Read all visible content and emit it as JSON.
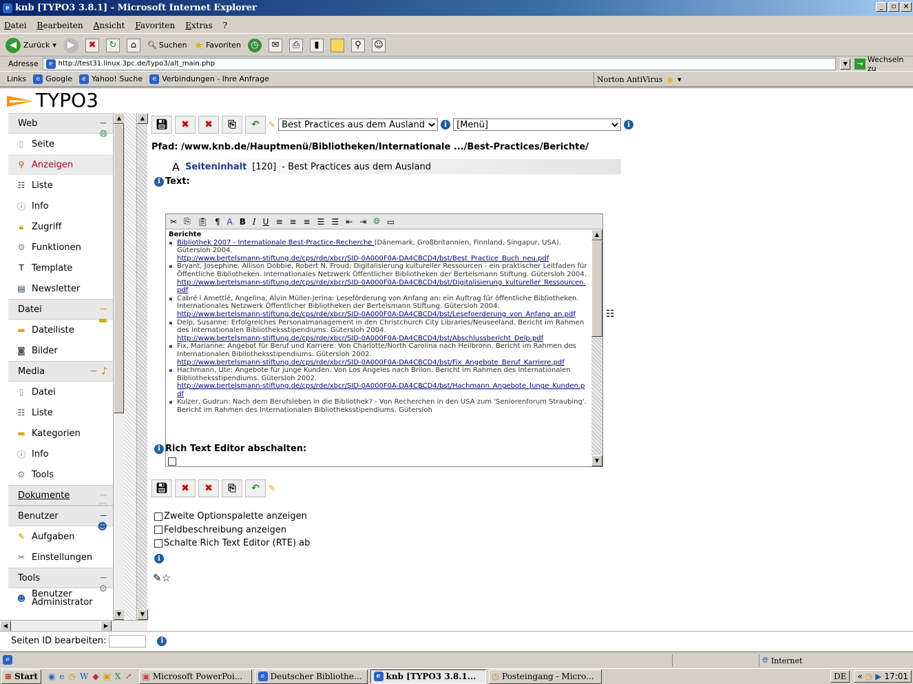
{
  "window": {
    "title": "knb [TYPO3 3.8.1] - Microsoft Internet Explorer"
  },
  "menu": [
    "Datei",
    "Bearbeiten",
    "Ansicht",
    "Favoriten",
    "Extras",
    "?"
  ],
  "nav": {
    "back": "Zurück",
    "search": "Suchen",
    "favorites": "Favoriten"
  },
  "address": {
    "label": "Adresse",
    "url": "http://test31.linux.3pc.de/typo3/alt_main.php",
    "go": "Wechseln zu"
  },
  "links": {
    "label": "Links",
    "items": [
      "Google",
      "Yahoo! Suche",
      "Verbindungen - Ihre Anfrage"
    ],
    "antivirus": "Norton AntiVirus"
  },
  "typo3": {
    "logo": "TYPO3",
    "sidebar": [
      {
        "type": "group",
        "label": "Web",
        "icon": "globe-icon"
      },
      {
        "type": "mod",
        "label": "Seite",
        "icon": "page-icon"
      },
      {
        "type": "mod",
        "label": "Anzeigen",
        "icon": "magnifier-icon",
        "active": true
      },
      {
        "type": "mod",
        "label": "Liste",
        "icon": "list-icon"
      },
      {
        "type": "mod",
        "label": "Info",
        "icon": "info-icon"
      },
      {
        "type": "mod",
        "label": "Zugriff",
        "icon": "lock-icon"
      },
      {
        "type": "mod",
        "label": "Funktionen",
        "icon": "gear-icon"
      },
      {
        "type": "mod",
        "label": "Template",
        "icon": "template-icon"
      },
      {
        "type": "mod",
        "label": "Newsletter",
        "icon": "newsletter-icon"
      },
      {
        "type": "group",
        "label": "Datei",
        "icon": "folder-icon"
      },
      {
        "type": "mod",
        "label": "Dateiliste",
        "icon": "folder-icon"
      },
      {
        "type": "mod",
        "label": "Bilder",
        "icon": "camera-icon"
      },
      {
        "type": "group",
        "label": "Media",
        "icon": "media-icon"
      },
      {
        "type": "mod",
        "label": "Datei",
        "icon": "file-icon"
      },
      {
        "type": "mod",
        "label": "Liste",
        "icon": "list-icon"
      },
      {
        "type": "mod",
        "label": "Kategorien",
        "icon": "folder-icon"
      },
      {
        "type": "mod",
        "label": "Info",
        "icon": "info-icon"
      },
      {
        "type": "mod",
        "label": "Tools",
        "icon": "gear-icon"
      },
      {
        "type": "group",
        "label": "Dokumente",
        "icon": "doc-icon",
        "link": true
      },
      {
        "type": "group",
        "label": "Benutzer",
        "icon": "user-icon"
      },
      {
        "type": "mod",
        "label": "Aufgaben",
        "icon": "pencil-icon"
      },
      {
        "type": "mod",
        "label": "Einstellungen",
        "icon": "tools-icon"
      },
      {
        "type": "group",
        "label": "Tools",
        "icon": "gear-icon"
      },
      {
        "type": "mod",
        "label": "Benutzer Administrator",
        "icon": "user-icon"
      }
    ],
    "page_select": "Best Practices aus dem Ausland",
    "menu_select": "[Menü]",
    "path": "Pfad: /www.knb.de/Hauptmenü/Bibliotheken/Internationale .../Best-Practices/Berichte/",
    "record_title": "Seiteninhalt",
    "record_id": "[120]",
    "record_suffix": "- Best Practices aus dem Ausland",
    "text_label": "Text:",
    "rte_heading": "Berichte",
    "rte_items": [
      {
        "link": "Bibliothek 2007 - Internationale Best-Practice-Recherche ",
        "text": "(Dänemark, Großbritannien, Finnland, Singapur, USA). Gütersloh 2004.",
        "url": "http://www.bertelsmann-stiftung.de/cps/rde/xbcr/SID-0A000F0A-DA4CBCD4/bst/Best_Practice_Buch_neu.pdf"
      },
      {
        "text": "Bryant, Josephine, Allison Dobbie, Robert N. Froud: Digitalisierung kultureller Ressourcen - ein praktischer Leitfaden für Öffentliche Bibliotheken. Internationales Netzwerk Öffentlicher Bibliotheken der Bertelsmann Stiftung. Gütersloh 2004.",
        "url": "http://www.bertelsmann-stiftung.de/cps/rde/xbcr/SID-0A000F0A-DA4CBCD4/bst/Digitalisierung_kultureller_Ressourcen.pdf"
      },
      {
        "text": "Cabré i Amettlé, Angelina, Alvin Müller-Jerina: Leseförderung von Anfang an: ein Auftrag für öffentliche Bibliotheken. Internationales Netzwerk Öffentlicher Bibliotheken der Bertelsmann Stiftung. Gütersloh 2004.",
        "url": "http://www.bertelsmann-stiftung.de/cps/rde/xbcr/SID-0A000F0A-DA4CBCD4/bst/Lesefoerderung_von_Anfang_an.pdf"
      },
      {
        "text": "Delp, Susanne: Erfolgreiches Personalmanagement in den Christchurch City Libraries/Neuseeland. Bericht im Rahmen des Internationalen Bibliotheksstipendiums. Gütersloh 2004.",
        "url": "http://www.bertelsmann-stiftung.de/cps/rde/xbcr/SID-0A000F0A-DA4CBCD4/bst/Abschlussbericht_Delp.pdf"
      },
      {
        "text": "Fix, Marianne: Angebot für Beruf und Karriere. Von Charlotte/North Carolina nach Heilbronn. Bericht im Rahmen des Internationalen Bibliotheksstipendiums. Gütersloh 2002.",
        "url": "http://www.bertelsmann-stiftung.de/cps/rde/xbcr/SID-0A000F0A-DA4CBCD4/bst/Fix_Angebote_Beruf_Karriere.pdf"
      },
      {
        "text": "Hachmann, Ute: Angebote für junge Kunden. Von Los Angeles nach Brilon. Bericht im Rahmen des Internationalen Bibliotheksstipendiums. Gütersloh 2002.",
        "url": "http://www.bertelsmann-stiftung.de/cps/rde/xbcr/SID-0A000F0A-DA4CBCD4/bst/Hachmann_Angebote_Junge_Kunden.pdf"
      },
      {
        "text": "Kulzer, Gudrun: Nach dem Berufsleben in die Bibliothek? - Von Recherchen in den USA zum 'Seniorenforum Straubing'. Bericht im Rahmen des Internationalen Bibliotheksstipendiums. Gütersloh"
      }
    ],
    "rte_off_label": "Rich Text Editor abschalten:",
    "options": [
      "Zweite Optionspalette anzeigen",
      "Feldbeschreibung anzeigen",
      "Schalte Rich Text Editor (RTE) ab"
    ],
    "page_id_label": "Seiten ID bearbeiten:"
  },
  "status": {
    "zone": "Internet"
  },
  "taskbar": {
    "start": "Start",
    "tasks": [
      "Microsoft PowerPoi...",
      "Deutscher Bibliothe...",
      "knb [TYPO3 3.8.1...",
      "Posteingang - Micro..."
    ],
    "lang": "DE",
    "time": "17:01"
  }
}
